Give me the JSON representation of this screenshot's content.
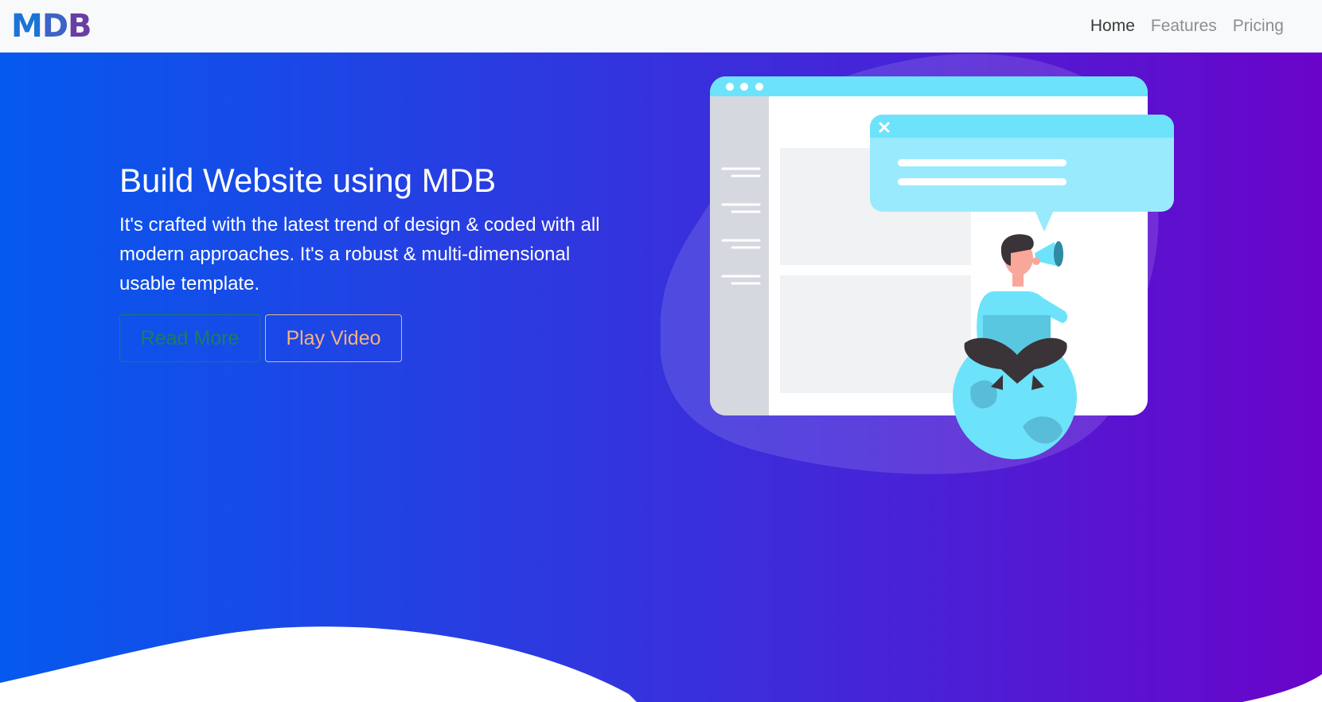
{
  "brand": {
    "logo_text_1": "M",
    "logo_text_2": "D",
    "logo_text_3": "B"
  },
  "nav": {
    "items": [
      {
        "label": "Home",
        "active": true
      },
      {
        "label": "Features"
      },
      {
        "label": "Pricing"
      }
    ]
  },
  "hero": {
    "title": "Build Website using MDB",
    "subtitle": "It's crafted with the latest trend of design & coded with all modern approaches. It's a robust & multi-dimensional usable template.",
    "read_more_label": "Read More",
    "play_video_label": "Play Video"
  },
  "colors": {
    "gradient_start": "#0559ee",
    "gradient_end": "#6a04c9",
    "illustration_accent": "#6ce3fb"
  }
}
